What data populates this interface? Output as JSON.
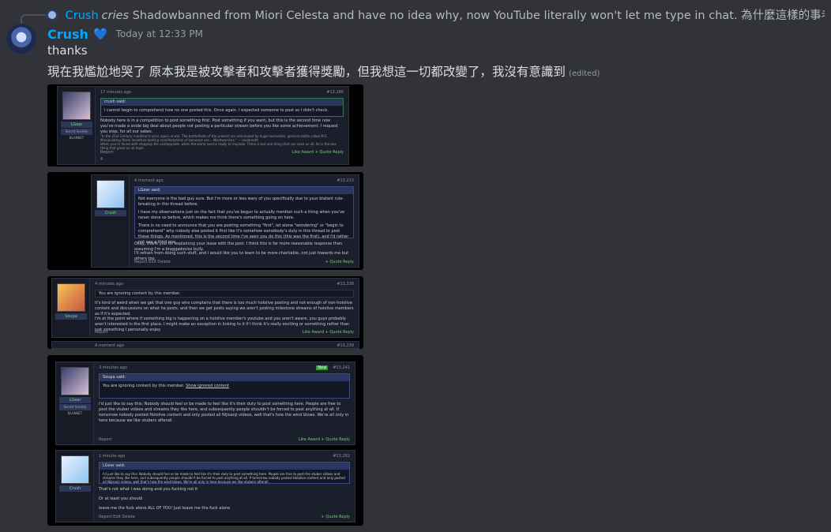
{
  "reply": {
    "author": "Crush",
    "verb": "cries",
    "text": "Shadowbanned from Miori Celesta and have no idea why, now YouTube literally won't let me type in chat. 為什麼這樣的事老是發生在我身上？　Hugs?"
  },
  "message": {
    "author": "Crush",
    "badge_icon": "heart-icon",
    "timestamp": "Today at 12:33 PM",
    "lines": [
      "thanks",
      "現在我尷尬地哭了 原本我是被攻擊者和攻擊者獲得獎勵，但我想這一切都改變了，我沒有意識到"
    ],
    "edited": "(edited)"
  },
  "attachments": [
    {
      "time": "17 minutes ago",
      "num": "#13,186",
      "user": "LGear",
      "user_sub": "Secret Society BLANKET",
      "quote_head": "crush said:",
      "quote": "I cannot begin to comprehend how no one posted this. Once again. I expected someone to post so I didn't check.",
      "body": "Nobody here is in a competition to post something first. Post something if you want, but this is the second time now you've made a snide big deal about people not posting a particular stream before you like some achievement. I request you stop, for all our sakes.",
      "sig1": "\"In the 21st Century mankind is once again at war. The battlefields of the present are dominated by huge humanlike, general battle called M.S. Manipulating these leviathan-looking manifestations of someone are... Mechwarriors.\" — exobreath",
      "sig2": "When you're faced with stepping the unstoppable, when the world seems ready to implode. There is but one thing that can save us all: he is the one thing that gives us all hope.",
      "report": "Report",
      "reactions": "Like  Award  + Quote  Reply",
      "likes": "4"
    },
    {
      "time": "4 moment ago",
      "num": "#13,233",
      "user": "Crush",
      "quote_head": "LGear said:",
      "quote1": "Not everyone is the bad guy sure. But I'm more or less wary of you specifically due to your blatant rule-breaking in this thread before.",
      "quote2": "I have my observations just on the fact that you've begun to actually mention such a thing when you've never done so before, which makes me think there's something going on here.",
      "quote3": "There is no need to announce that you are posting something \"first\", let alone \"wondering\" or \"begin to comprehend\" why nobody else posted it first like it's somehow somebody's duty in this thread to post these things. As mentioned, this is the second time I've seen you do this (this was the first), and I'd rather not see a third one.",
      "body1": "Okay, thank you for explaining your issue with the post. I think this is far more reasonable response than assuming I'm a braggadocios bully.",
      "body2": "I'll refrain from doing such stuff, and I would like you to learn to be more charitable, not just towards me but others too.",
      "footer": "Report  Edit  Delete",
      "reactions": "+ Quote  Reply"
    },
    {
      "time": "4 minutes ago",
      "num": "#13,238",
      "user": "Soupa",
      "ignored": "You are ignoring content by this member.",
      "body1": "It's kind of weird when we get that one guy who complains that there is too much hololive posting and not enough of non-hololive content and discussions on what he posts, and then we get posts saying we aren't posting milestone streams of hololive members as if it's expected.",
      "body2": "I'm at the point where if something big is happening on a hololive member's youtube and you aren't aware, you guys probably aren't interested in the first place. I might make an exception in linking to it if I think it's really exciting or something rather than just something I personally enjoy.",
      "report": "Report",
      "reactions": "Like  Award  + Quote  Reply",
      "next_time": "A moment ago",
      "next_num": "#13,239"
    },
    {
      "time": "3 minutes ago",
      "num": "#13,241",
      "new_badge": "New",
      "user": "LGear",
      "user_sub": "Secret Society BLANKET",
      "quote_head": "Soupa said:",
      "ignored": "You are ignoring content by this member.",
      "show_ignored": "Show ignored content",
      "body": "I'd just like to say this: Nobody should feel or be made to feel like it's their duty to post something here. People are free to post the vtuber videos and streams they like here, and subsequently people shouldn't be forced to post anything at all. If tomorrow nobody posted Hololive content and only posted all Nijisanji videos, well that's how the wind blows. We're all only in here because we like vtubers afterall.",
      "report": "Report",
      "reactions": "Like  Award  + Quote  Reply",
      "time2": "1 minute ago",
      "num2": "#13,262",
      "user2": "Crush",
      "quote2_head": "LGear said:",
      "quote2": "I'd just like to say this: Nobody should feel or be made to feel like it's their duty to post something here. People are free to post the vtuber videos and streams they like here, and subsequently people shouldn't be forced to post anything at all. If tomorrow nobody posted Hololive content and only posted all Nijisanji videos, well that's how the wind blows. We're all only in here because we like vtubers afterall.",
      "body2a": "That's not what I was doing and you fucking not it",
      "body2b": "Or at least you should",
      "body2c": "leave me the fuck alone ALL OF YOU! Just leave me the fuck alone",
      "footer2": "Report  Edit  Delete",
      "reactions2": "+ Quote  Reply"
    }
  ]
}
